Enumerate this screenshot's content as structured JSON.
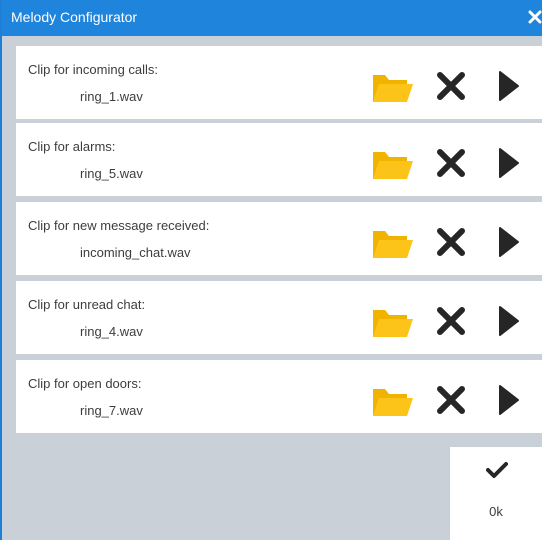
{
  "window": {
    "title": "Melody Configurator",
    "close_icon": "close-icon"
  },
  "rows": [
    {
      "label": "Clip for incoming calls:",
      "file": "ring_1.wav"
    },
    {
      "label": "Clip for alarms:",
      "file": "ring_5.wav"
    },
    {
      "label": "Clip for new message received:",
      "file": "incoming_chat.wav"
    },
    {
      "label": "Clip for unread chat:",
      "file": "ring_4.wav"
    },
    {
      "label": "Clip for open doors:",
      "file": "ring_7.wav"
    }
  ],
  "row_icons": {
    "browse": "folder-icon",
    "remove": "x-icon",
    "play": "play-icon"
  },
  "ok_button": {
    "label": "0k",
    "icon": "checkmark-icon"
  },
  "colors": {
    "titlebar": "#1f84dc",
    "background": "#c9d0d7",
    "folder": "#fcc419",
    "icon_dark": "#262626"
  }
}
